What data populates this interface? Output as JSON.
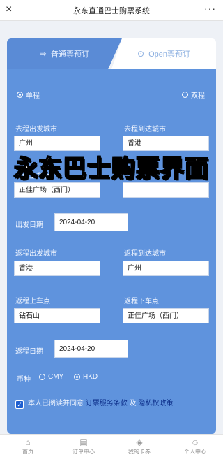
{
  "app": {
    "title": "永东直通巴士购票系统",
    "close_icon": "×",
    "more_icon": "···"
  },
  "tabs": [
    {
      "label": "普通票预订",
      "icon": "bus-icon",
      "glyph": "⇨"
    },
    {
      "label": "Open票预订",
      "icon": "open-ticket-icon",
      "glyph": "⊙"
    }
  ],
  "trip_type": {
    "one_way": "单程",
    "round_trip": "双程",
    "selected": "one_way"
  },
  "outbound": {
    "from_city_label": "去程出发城市",
    "from_city_value": "广州",
    "to_city_label": "去程到达城市",
    "to_city_value": "香港",
    "board_label": "去程上车点",
    "board_value": "正佳广场（西门）",
    "date_label": "出发日期",
    "date_value": "2024-04-20"
  },
  "return": {
    "from_city_label": "返程出发城市",
    "from_city_value": "香港",
    "to_city_label": "返程到达城市",
    "to_city_value": "广州",
    "board_label": "返程上车点",
    "board_value": "钻石山",
    "alight_label": "返程下车点",
    "alight_value": "正佳广场（西门）",
    "date_label": "返程日期",
    "date_value": "2024-04-20"
  },
  "currency": {
    "label": "币种",
    "options": [
      "CMY",
      "HKD"
    ],
    "selected": "HKD"
  },
  "agreement": {
    "text": "本人已阅读并同意",
    "link1": "订票服务条款",
    "and": "及",
    "link2": "隐私权政策",
    "checked": true
  },
  "overlay_title": "永东巴士购票界面",
  "bottom_nav": [
    {
      "label": "首页",
      "icon": "home-icon",
      "glyph": "⌂"
    },
    {
      "label": "订单中心",
      "icon": "orders-icon",
      "glyph": "▤"
    },
    {
      "label": "我的卡券",
      "icon": "coupon-icon",
      "glyph": "◈"
    },
    {
      "label": "个人中心",
      "icon": "user-icon",
      "glyph": "☺"
    }
  ],
  "colors": {
    "panel": "#5f93dd",
    "tab_active": "#5a8bd6",
    "link": "#0d2f8a",
    "checkbox": "#1e5fd0"
  }
}
